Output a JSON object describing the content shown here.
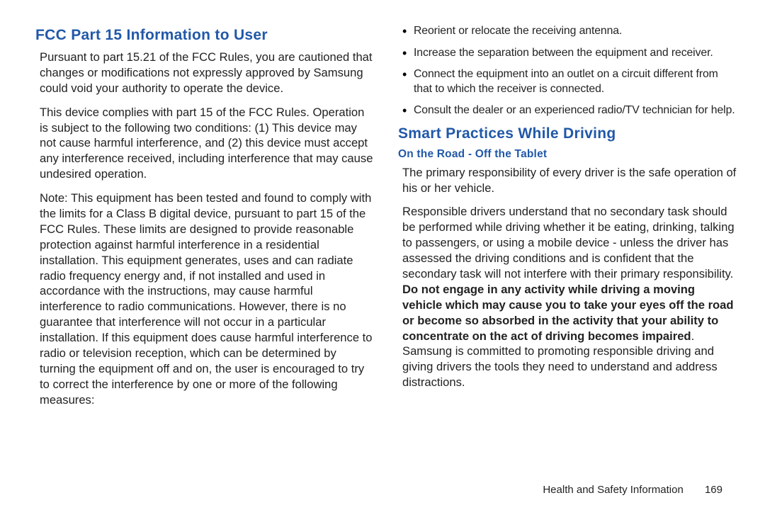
{
  "left": {
    "heading": "FCC Part 15 Information to User",
    "p1": "Pursuant to part 15.21 of the FCC Rules, you are cautioned that changes or modifications not expressly approved by Samsung could void your authority to operate the device.",
    "p2": "This device complies with part 15 of the FCC Rules. Operation is subject to the following two conditions: (1) This device may not cause harmful interference, and (2) this device must accept any interference received, including interference that may cause undesired operation.",
    "p3": "Note: This equipment has been tested and found to comply with the limits for a Class B digital device, pursuant to part 15 of the FCC Rules. These limits are designed to provide reasonable protection against harmful interference in a residential installation. This equipment generates, uses and can radiate radio frequency energy and, if not installed and used in accordance with the instructions, may cause harmful interference to radio communications. However, there is no guarantee that interference will not occur in a particular installation. If this equipment does cause harmful interference to radio or television reception, which can be determined by turning the equipment off and on, the user is encouraged to try to correct the interference by one or more of the following measures:"
  },
  "right": {
    "bullets": [
      "Reorient or relocate the receiving antenna.",
      "Increase the separation between the equipment and receiver.",
      "Connect the equipment into an outlet on a circuit different from that to which the receiver is connected.",
      "Consult the dealer or an experienced radio/TV technician for help."
    ],
    "heading2": "Smart Practices While Driving",
    "subheading": "On the Road - Off the Tablet",
    "p4": "The primary responsibility of every driver is the safe operation of his or her vehicle.",
    "p5a": "Responsible drivers understand that no secondary task should be performed while driving whether it be eating, drinking, talking to passengers, or using a mobile device - unless the driver has assessed the driving conditions and is confident that the secondary task will not interfere with their primary responsibility. ",
    "p5b": "Do not engage in any activity while driving a moving vehicle which may cause you to take your eyes off the road or become so absorbed in the activity that your ability to concentrate on the act of driving becomes impaired",
    "p5c": ". Samsung is committed to promoting responsible driving and giving drivers the tools they need to understand and address distractions."
  },
  "footer": {
    "section": "Health and Safety Information",
    "page": "169"
  }
}
